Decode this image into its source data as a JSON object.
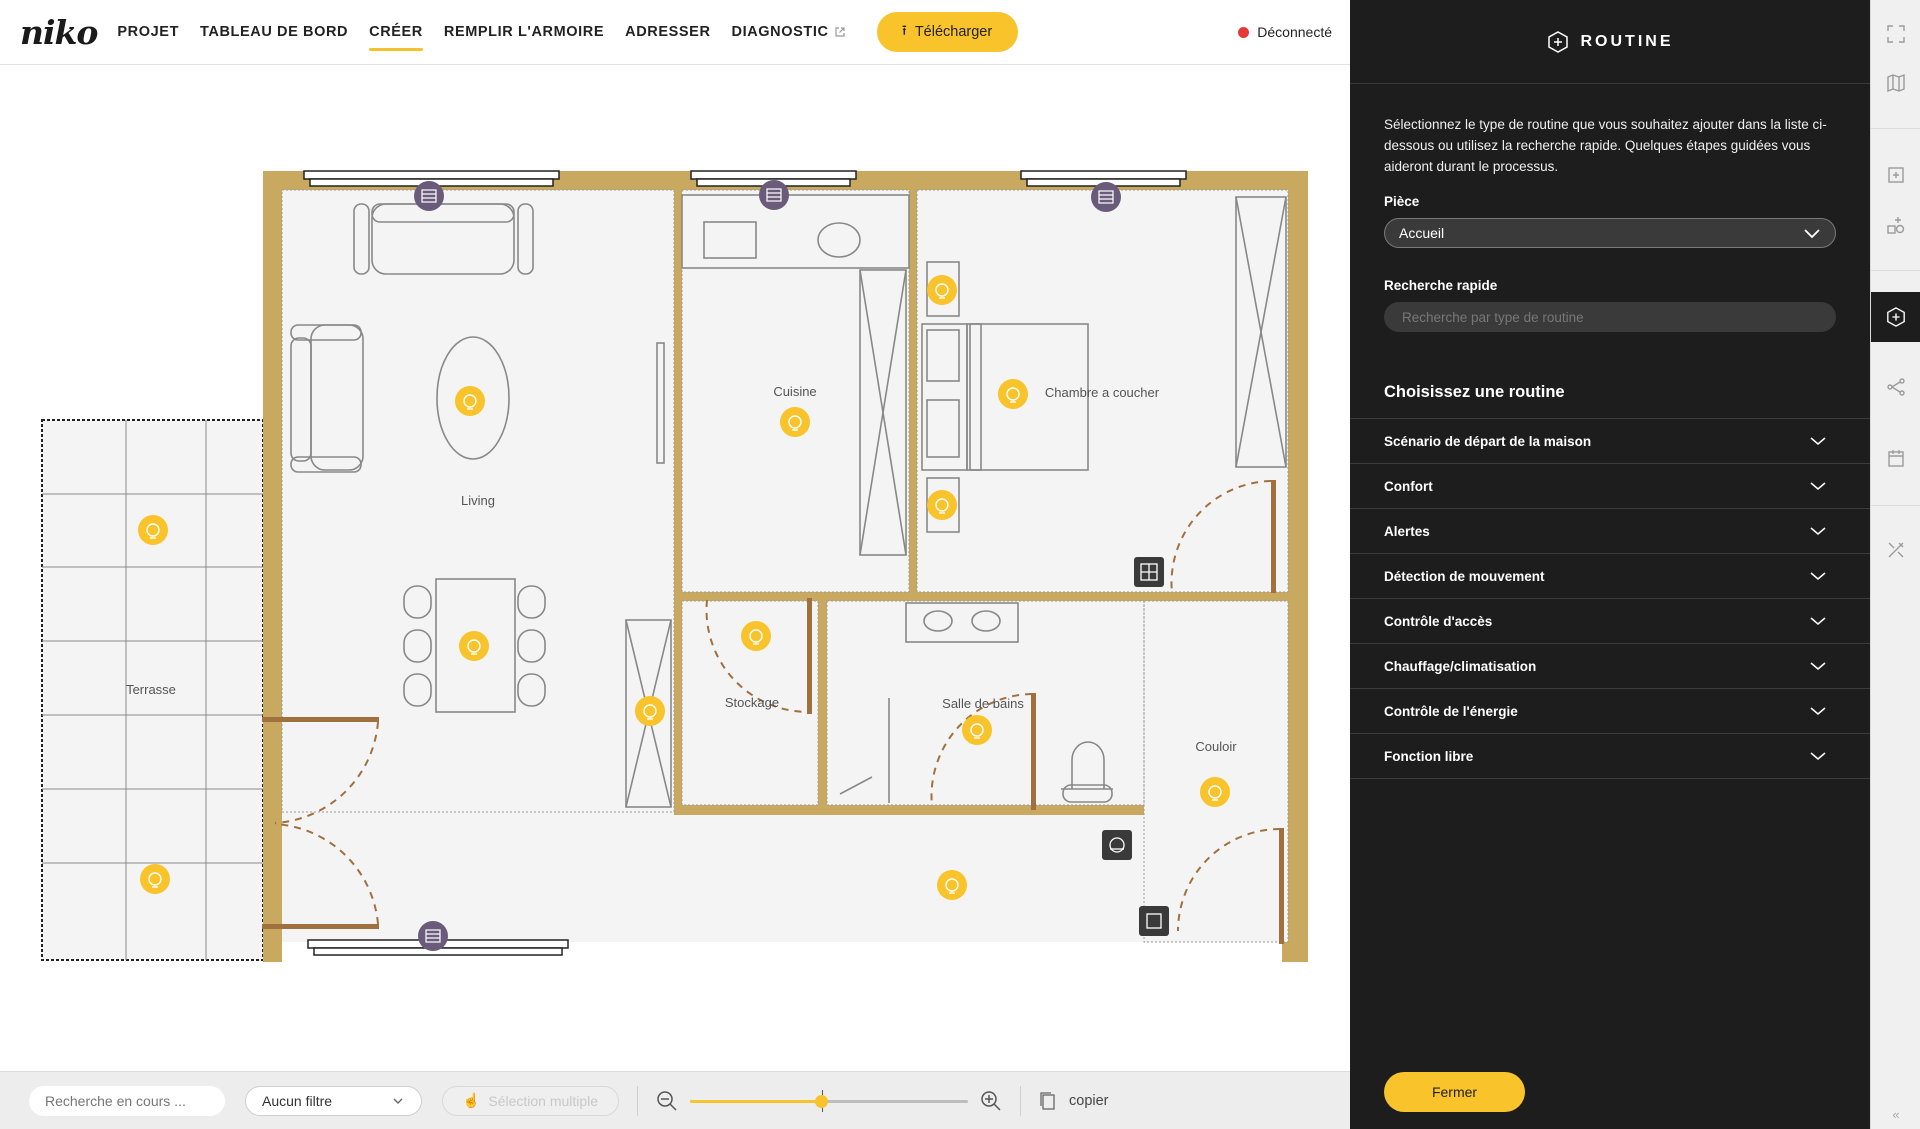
{
  "app": {
    "logo": "niko"
  },
  "nav": {
    "items": [
      {
        "label": "PROJET"
      },
      {
        "label": "TABLEAU DE BORD"
      },
      {
        "label": "CRÉER",
        "active": true
      },
      {
        "label": "REMPLIR L'ARMOIRE"
      },
      {
        "label": "ADRESSER"
      },
      {
        "label": "DIAGNOSTIC",
        "external": true
      }
    ],
    "download_label": "Télécharger",
    "status_label": "Déconnecté",
    "status_color": "#e53935"
  },
  "floorplan": {
    "rooms": [
      "Living",
      "Cuisine",
      "Chambre a coucher",
      "Terrasse",
      "Stockage",
      "Salle de bains",
      "Couloir"
    ],
    "colors": {
      "wall": "#c9a95f",
      "floor": "#f4f4f4",
      "door": "#a0703f",
      "light": "#f9c32c",
      "shutter": "#6b5b7b"
    }
  },
  "bottombar": {
    "search_placeholder": "Recherche en cours ...",
    "filter_label": "Aucun filtre",
    "multi_select_label": "Sélection multiple",
    "zoom_level": 0.47,
    "copy_label": "copier"
  },
  "panel": {
    "title": "ROUTINE",
    "intro": "Sélectionnez le type de routine que vous souhaitez ajouter dans la liste ci-dessous ou utilisez la recherche rapide. Quelques étapes guidées vous aideront durant le processus.",
    "room_label": "Pièce",
    "room_value": "Accueil",
    "quick_search_label": "Recherche rapide",
    "quick_search_placeholder": "Recherche par type de routine",
    "choose_title": "Choisissez une routine",
    "categories": [
      "Scénario de départ de la maison",
      "Confort",
      "Alertes",
      "Détection de mouvement",
      "Contrôle d'accès",
      "Chauffage/climatisation",
      "Contrôle de l'énergie",
      "Fonction libre"
    ],
    "close_label": "Fermer"
  },
  "rail": {
    "icons": [
      "fullscreen-icon",
      "map-icon",
      "add-device-icon",
      "add-shapes-icon",
      "routine-icon",
      "connections-icon",
      "calendar-icon",
      "tools-icon"
    ],
    "active": "routine-icon",
    "collapse_label": "«"
  }
}
